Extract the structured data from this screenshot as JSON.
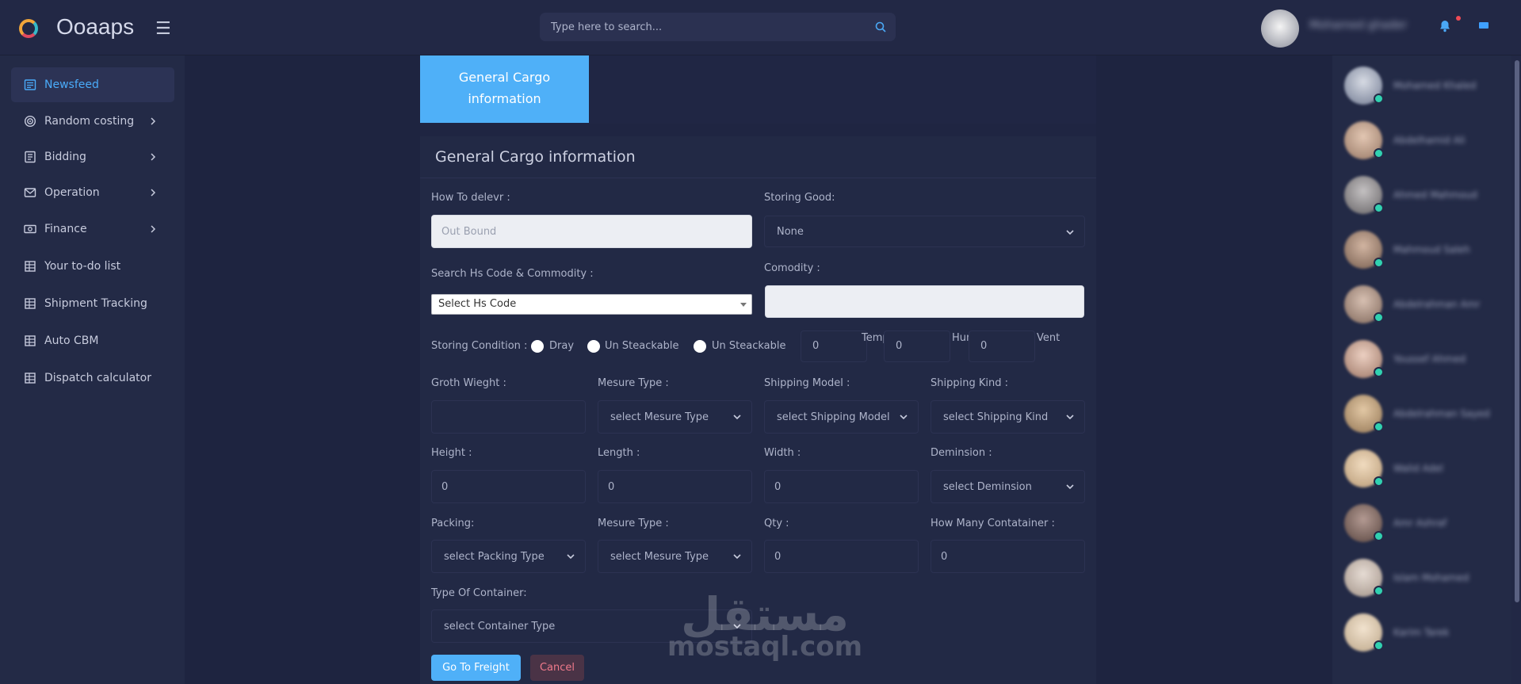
{
  "app": {
    "name": "Ooaaps"
  },
  "header": {
    "search_placeholder": "Type here to search...",
    "user_name": "Mohamed ghader"
  },
  "sidebar": {
    "items": [
      {
        "label": "Newsfeed",
        "icon": "newspaper-icon",
        "active": true,
        "has_chevron": false
      },
      {
        "label": "Random costing",
        "icon": "target-icon",
        "active": false,
        "has_chevron": true
      },
      {
        "label": "Bidding",
        "icon": "list-icon",
        "active": false,
        "has_chevron": true
      },
      {
        "label": "Operation",
        "icon": "mail-icon",
        "active": false,
        "has_chevron": true
      },
      {
        "label": "Finance",
        "icon": "money-icon",
        "active": false,
        "has_chevron": true
      },
      {
        "label": "Your to-do list",
        "icon": "building-icon",
        "active": false,
        "has_chevron": false
      },
      {
        "label": "Shipment Tracking",
        "icon": "building-icon",
        "active": false,
        "has_chevron": false
      },
      {
        "label": "Auto CBM",
        "icon": "building-icon",
        "active": false,
        "has_chevron": false
      },
      {
        "label": "Dispatch calculator",
        "icon": "building-icon",
        "active": false,
        "has_chevron": false
      }
    ]
  },
  "tab": {
    "line1": "General Cargo",
    "line2": "information"
  },
  "form": {
    "title": "General Cargo information",
    "how_to_deliver": {
      "label": "How To delevr :",
      "placeholder": "Out Bound"
    },
    "storing_good": {
      "label": "Storing Good:",
      "value": "None"
    },
    "hs_code": {
      "label": "Search Hs Code & Commodity :",
      "value": "Select Hs Code"
    },
    "commodity": {
      "label": "Comodity :",
      "value": ""
    },
    "storing_condition": {
      "label": "Storing Condition :",
      "options": [
        "Dray",
        "Un Steackable",
        "Un Steackable"
      ],
      "temp": {
        "label": "Temp",
        "value": "0"
      },
      "hum": {
        "label": "Hum",
        "value": "0"
      },
      "vent": {
        "label": "Vent",
        "value": "0"
      }
    },
    "gross_weight": {
      "label": "Groth Wieght :",
      "value": ""
    },
    "measure_type": {
      "label": "Mesure Type :",
      "value": "select Mesure Type"
    },
    "shipping_model": {
      "label": "Shipping Model :",
      "value": "select Shipping Model"
    },
    "shipping_kind": {
      "label": "Shipping Kind :",
      "value": "select Shipping Kind"
    },
    "height": {
      "label": "Height :",
      "value": "0"
    },
    "length": {
      "label": "Length :",
      "value": "0"
    },
    "width": {
      "label": "Width :",
      "value": "0"
    },
    "dimension": {
      "label": "Deminsion :",
      "value": "select Deminsion"
    },
    "packing": {
      "label": "Packing:",
      "value": "select Packing Type"
    },
    "measure_type_2": {
      "label": "Mesure Type :",
      "value": "select Mesure Type"
    },
    "qty": {
      "label": "Qty :",
      "value": "0"
    },
    "containers": {
      "label": "How Many Contatainer :",
      "value": "0"
    },
    "container_type": {
      "label": "Type Of Container:",
      "value": "select Container Type"
    },
    "submit_label": "Go To Freight",
    "cancel_label": "Cancel"
  },
  "contacts": [
    {
      "name": "Mohamed Khaled",
      "color": "#8a92a6"
    },
    {
      "name": "Abdelhamid Ali",
      "color": "#a98b78"
    },
    {
      "name": "Ahmed Mahmoud",
      "color": "#7d7a7c"
    },
    {
      "name": "Mahmoud Saleh",
      "color": "#8d7363"
    },
    {
      "name": "Abdelrahman Amr",
      "color": "#957d70"
    },
    {
      "name": "Youssef Ahmed",
      "color": "#b08c7c"
    },
    {
      "name": "Abdelrahman Sayed",
      "color": "#a78a68"
    },
    {
      "name": "Walid Adel",
      "color": "#c5a987"
    },
    {
      "name": "Amr Ashraf",
      "color": "#6f5a54"
    },
    {
      "name": "Islam Mohamed",
      "color": "#b2a49a"
    },
    {
      "name": "Karim Tarek",
      "color": "#c9b59a"
    }
  ],
  "watermark": {
    "arabic": "مستقل",
    "latin": "mostaql.com"
  }
}
